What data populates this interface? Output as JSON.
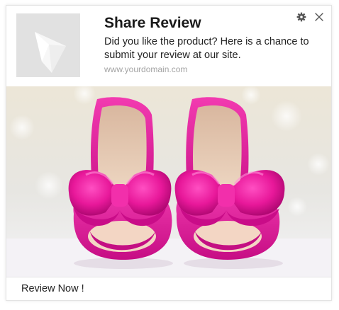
{
  "notification": {
    "title": "Share Review",
    "message": "Did you like the product? Here is a chance to submit your review at our site.",
    "domain": "www.yourdomain.com",
    "cta_label": "Review Now !",
    "icons": {
      "settings": "gear-icon",
      "close": "close-icon",
      "placeholder": "image-placeholder-icon"
    },
    "hero_image": "pink-bow-heels-photo"
  },
  "colors": {
    "icon_background": "#e1e1e1",
    "title_text": "#1a1a1a",
    "domain_text": "#a3a3a3",
    "shoe_pink": "#e8189a"
  }
}
